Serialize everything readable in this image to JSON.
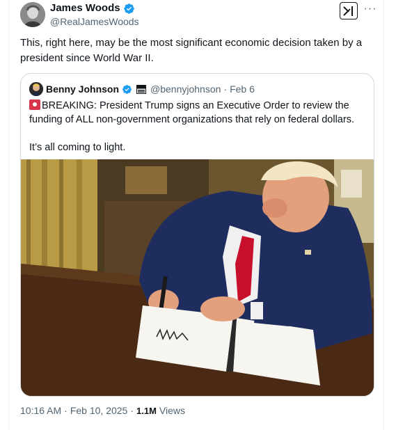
{
  "author": {
    "display_name": "James Woods",
    "handle": "@RealJamesWoods",
    "avatar_icon": "user-avatar-icon",
    "verified_color": "#1d9bf0"
  },
  "actions": {
    "grok_icon": "grok-icon",
    "more_label": "···"
  },
  "tweet": {
    "text": "This, right here, may be the most significant economic decision taken by a president since World War II."
  },
  "quoted": {
    "display_name": "Benny Johnson",
    "handle": "@bennyjohnson",
    "separator": "·",
    "date": "Feb 6",
    "text_1": "BREAKING: President Trump signs an Executive Order to review the funding of ALL non-government organizations that rely on federal dollars.",
    "text_2": "It’s all coming to light.",
    "emoji_icon": "siren-emoji-icon"
  },
  "footer": {
    "time": "10:16 AM",
    "separator": "·",
    "date": "Feb 10, 2025",
    "separator_2": "·",
    "views_count": "1.1M",
    "views_label": "Views"
  },
  "colors": {
    "text_primary": "#0f1419",
    "text_secondary": "#536471",
    "border": "#cfd9de",
    "verified_blue": "#1d9bf0"
  }
}
